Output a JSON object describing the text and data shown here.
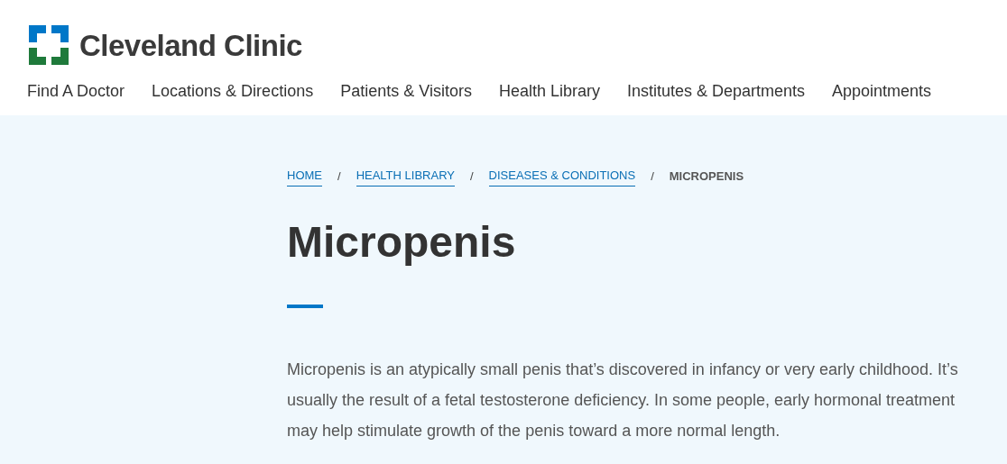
{
  "header": {
    "logo_text": "Cleveland Clinic",
    "nav": [
      "Find A Doctor",
      "Locations & Directions",
      "Patients & Visitors",
      "Health Library",
      "Institutes & Departments",
      "Appointments"
    ]
  },
  "breadcrumb": {
    "separator": "/",
    "items": [
      {
        "label": "HOME",
        "kind": "link"
      },
      {
        "label": "HEALTH LIBRARY",
        "kind": "link"
      },
      {
        "label": "DISEASES & CONDITIONS",
        "kind": "link"
      },
      {
        "label": "MICROPENIS",
        "kind": "current"
      }
    ]
  },
  "title": "Micropenis",
  "summary": "Micropenis is an atypically small penis that’s discovered in infancy or very early childhood. It’s usually the result of a fetal testosterone deficiency. In some people, early hormonal treatment may help stimulate growth of the penis toward a more normal length."
}
